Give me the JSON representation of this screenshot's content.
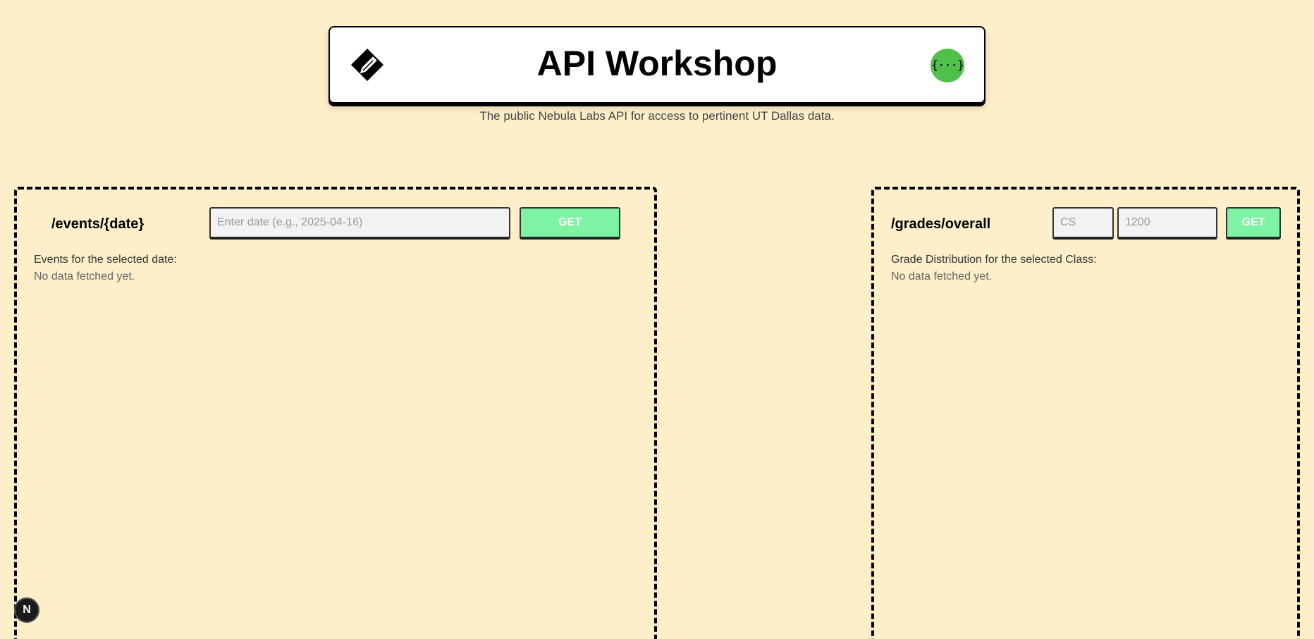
{
  "header": {
    "title": "API Workshop",
    "subtitle": "The public Nebula Labs API for access to pertinent UT Dallas data.",
    "api_icon_text": "{···}",
    "logo_icon": "pencil-diamond-icon",
    "accent_color": "#4fc14b"
  },
  "events_panel": {
    "endpoint": "/events/{date}",
    "date_input": {
      "value": "",
      "placeholder": "Enter date (e.g., 2025-04-16)"
    },
    "get_label": "GET",
    "description": "Events for the selected date:",
    "status": "No data fetched yet."
  },
  "grades_panel": {
    "endpoint": "/grades/overall",
    "subject_input": {
      "value": "",
      "placeholder": "CS"
    },
    "number_input": {
      "value": "",
      "placeholder": "1200"
    },
    "get_label": "GET",
    "description": "Grade Distribution for the selected Class:",
    "status": "No data fetched yet."
  },
  "badge": {
    "label": "N"
  },
  "colors": {
    "background": "#fdefc9",
    "button": "#7df3a3"
  }
}
